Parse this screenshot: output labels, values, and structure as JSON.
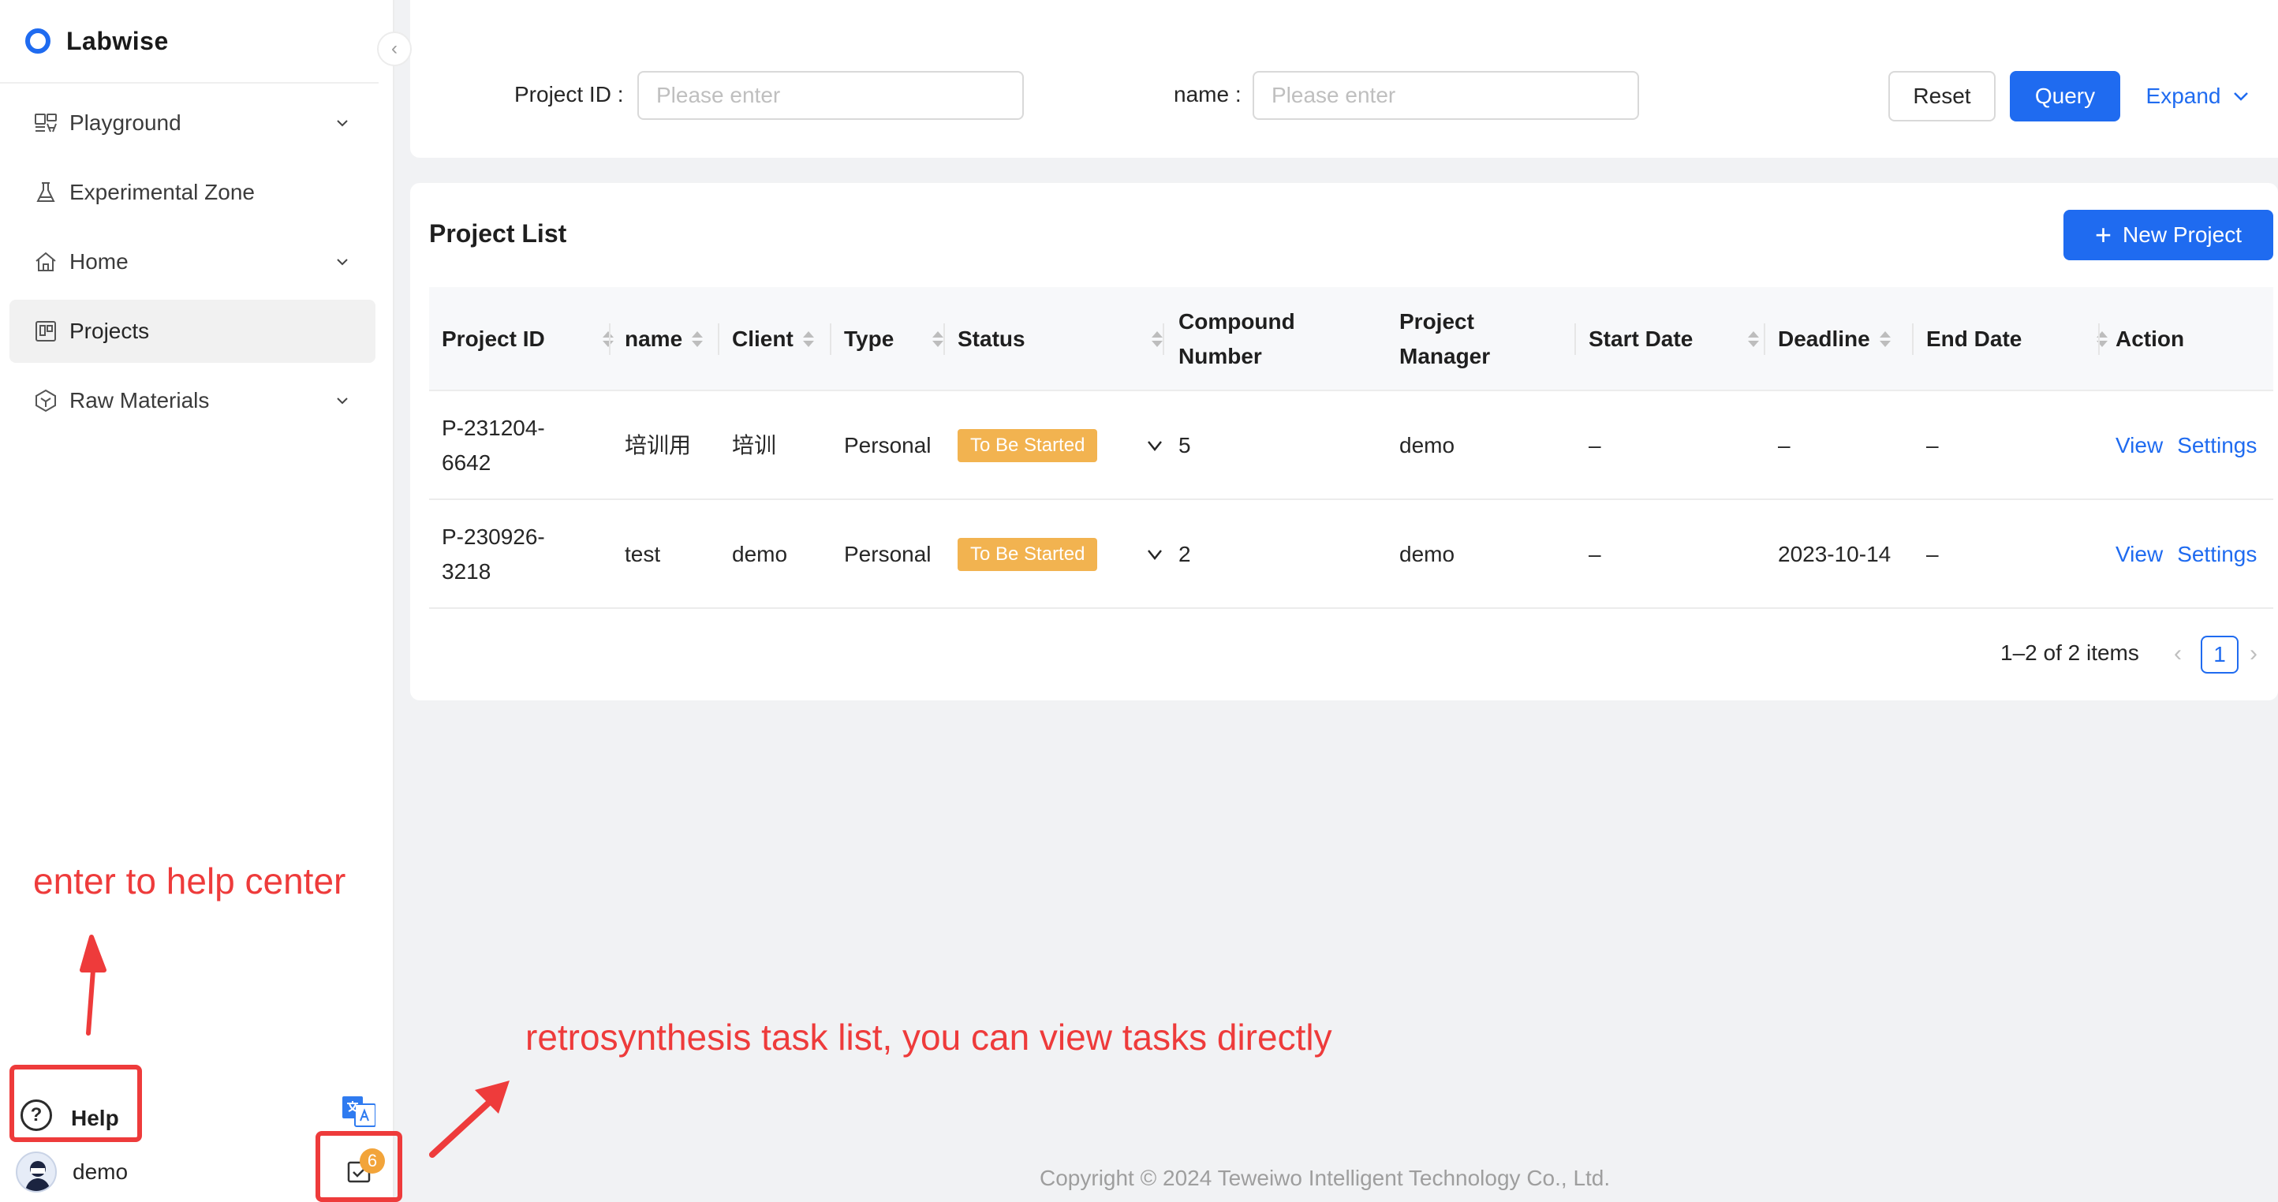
{
  "app": {
    "name": "Labwise",
    "collapse_glyph": "‹"
  },
  "sidebar": {
    "items": [
      {
        "label": "Playground",
        "icon": "playground-icon",
        "expandable": true,
        "active": false
      },
      {
        "label": "Experimental Zone",
        "icon": "flask-icon",
        "expandable": false,
        "active": false
      },
      {
        "label": "Home",
        "icon": "home-icon",
        "expandable": true,
        "active": false
      },
      {
        "label": "Projects",
        "icon": "projects-icon",
        "expandable": false,
        "active": true
      },
      {
        "label": "Raw Materials",
        "icon": "cube-icon",
        "expandable": true,
        "active": false
      }
    ],
    "help_label": "Help",
    "help_glyph": "?",
    "user_name": "demo",
    "task_badge_count": "6"
  },
  "search": {
    "project_id_label": "Project ID",
    "project_id_placeholder": "Please enter",
    "name_label": "name",
    "name_placeholder": "Please enter",
    "reset_label": "Reset",
    "query_label": "Query",
    "expand_label": "Expand"
  },
  "project_list": {
    "title": "Project List",
    "new_button_label": "New Project",
    "columns": [
      "Project ID",
      "name",
      "Client",
      "Type",
      "Status",
      "Compound Number",
      "Project Manager",
      "Start Date",
      "Deadline",
      "End Date",
      "Action"
    ],
    "rows": [
      {
        "project_id": "P-231204-6642",
        "name": "培训用",
        "client": "培训",
        "type": "Personal",
        "status": "To Be Started",
        "compound_number": "5",
        "project_manager": "demo",
        "start_date": "–",
        "deadline": "–",
        "end_date": "–",
        "actions": [
          "View",
          "Settings"
        ]
      },
      {
        "project_id": "P-230926-3218",
        "name": "test",
        "client": "demo",
        "type": "Personal",
        "status": "To Be Started",
        "compound_number": "2",
        "project_manager": "demo",
        "start_date": "–",
        "deadline": "2023-10-14",
        "end_date": "–",
        "actions": [
          "View",
          "Settings"
        ]
      }
    ],
    "pagination": {
      "total_text": "1–2 of 2 items",
      "current_page": "1"
    }
  },
  "footer": {
    "copyright": "Copyright © 2024  Teweiwo Intelligent Technology Co., Ltd."
  },
  "annotations": {
    "help_note": "enter to help center",
    "task_note": "retrosynthesis task list, you can view tasks directly",
    "color": "#ee3b3b"
  },
  "colors": {
    "primary": "#1f6bf0",
    "status_tag": "#f2b350",
    "badge": "#f2a43a"
  }
}
